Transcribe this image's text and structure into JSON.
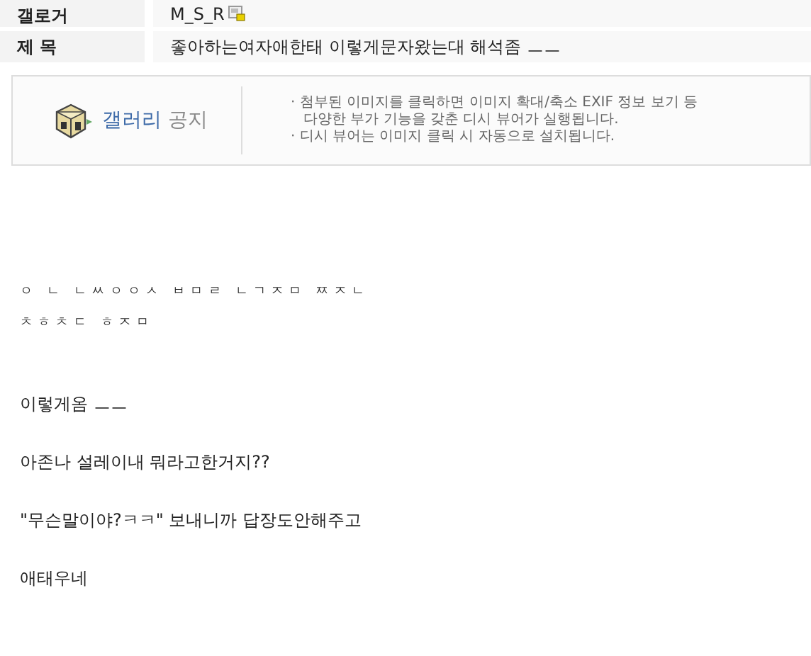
{
  "post_info": [
    {
      "label": "갤로거",
      "value": "M_S_R",
      "locked": true
    },
    {
      "label": "제 목",
      "value": "좋아하는여자애한태 이렇게문자왔는대 해석좀 ㅡㅡ",
      "locked": false
    }
  ],
  "notice": {
    "title_main": "갤러리",
    "title_sub": "공지",
    "lines": [
      "· 첨부된 이미지를 클릭하면 이미지 확대/축소 EXIF 정보 보기 등",
      "다양한 부가 기능을 갖춘 디시 뷰어가 실행됩니다.",
      "· 디시 뷰어는 이미지 클릭 시 자동으로 설치됩니다."
    ]
  },
  "body": [
    {
      "kind": "sms",
      "text": "ㅇ ㄴ ㄴㅆㅇㅇㅅ ㅂㅁㄹ ㄴㄱㅈㅁ ㅉㅈㄴ"
    },
    {
      "kind": "sms",
      "text": "ㅊㅎㅊㄷ ㅎㅈㅁ"
    },
    {
      "kind": "para",
      "text": "이렇게옴 ㅡㅡ"
    },
    {
      "kind": "para",
      "text": "아존나 설레이내 뭐라고한거지??"
    },
    {
      "kind": "para",
      "text": "\"무슨말이야?ㅋㅋ\" 보내니까 답장도안해주고"
    },
    {
      "kind": "para",
      "text": "애태우네"
    }
  ]
}
